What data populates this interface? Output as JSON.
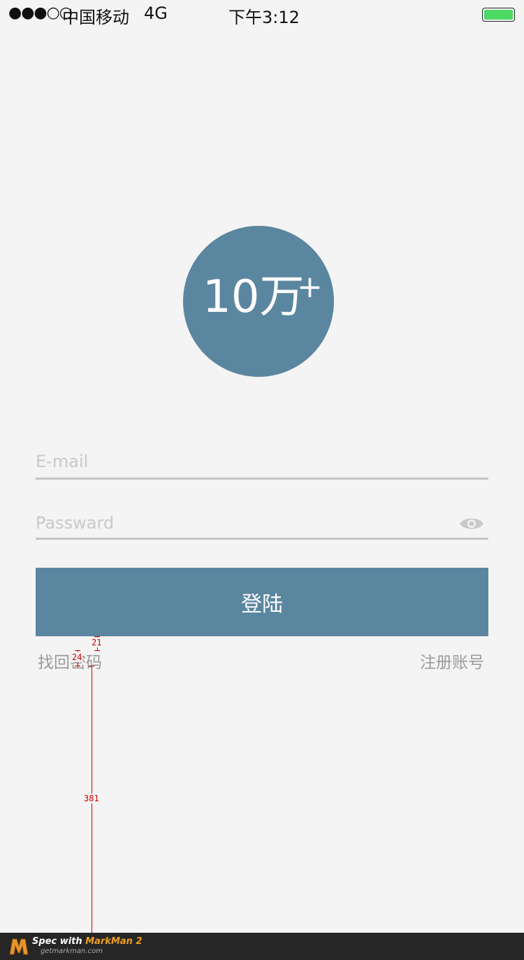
{
  "status_bar": {
    "signal": "●●●○○",
    "carrier": "中国移动",
    "network": "4G",
    "time": "下午3:12",
    "battery_level": 1.0
  },
  "logo": {
    "main_text": "10万",
    "sup_text": "+",
    "color": "#5b86a0"
  },
  "form": {
    "email_placeholder": "E-mail",
    "password_placeholder": "Passward",
    "login_label": "登陆",
    "forgot_label": "找回密码",
    "register_label": "注册账号"
  },
  "spec": {
    "label_gap_top": "21",
    "label_text_height": "24",
    "label_gap_bottom": "381"
  },
  "footer": {
    "spec_with": "Spec with ",
    "brand": "MarkMan 2",
    "url": "getmarkman.com"
  },
  "colors": {
    "accent": "#5b86a0",
    "background": "#f4f4f4",
    "battery": "#4cd964",
    "spec_red": "#cc0000"
  }
}
